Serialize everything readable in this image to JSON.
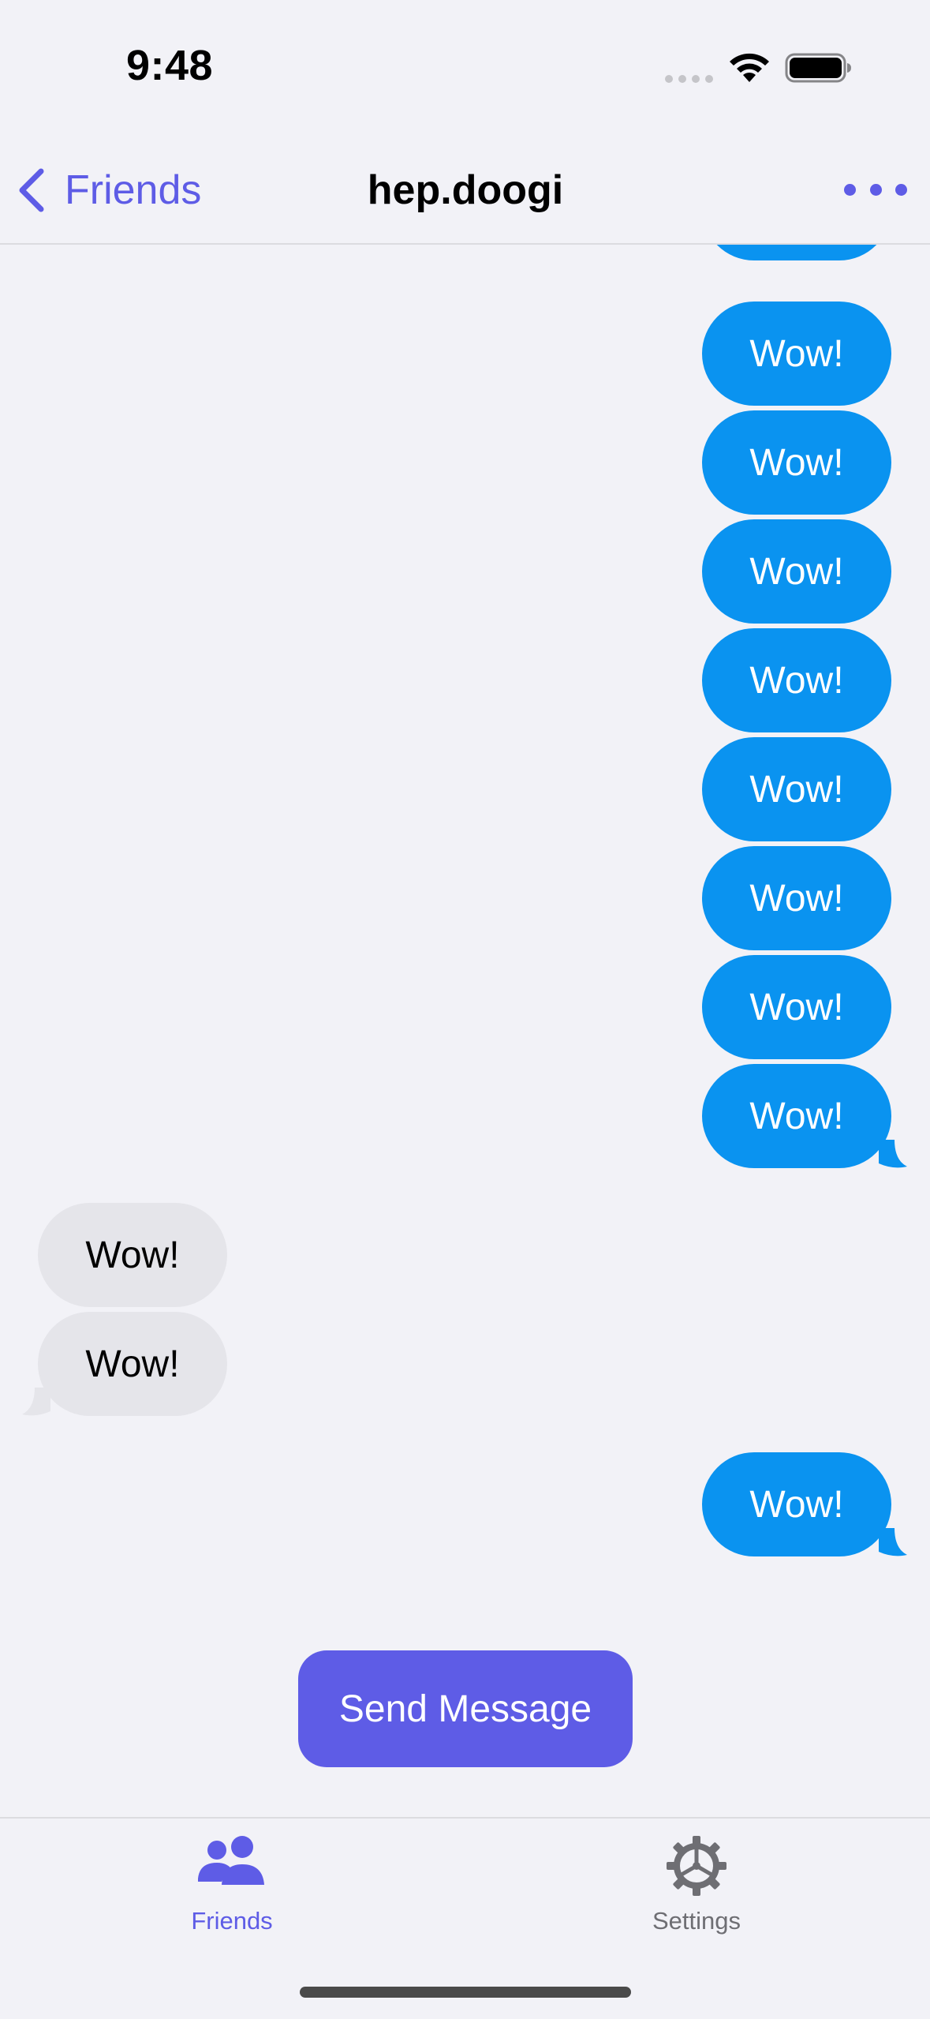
{
  "status_bar": {
    "time": "9:48",
    "wifi_icon": "wifi-icon",
    "battery_icon": "battery-full-icon"
  },
  "nav": {
    "back_label": "Friends",
    "back_icon": "chevron-left-icon",
    "title": "hep.doogi",
    "more_icon": "ellipsis-icon"
  },
  "messages": [
    {
      "direction": "out",
      "text": "Wow!"
    },
    {
      "direction": "out",
      "text": "Wow!"
    },
    {
      "direction": "out",
      "text": "Wow!"
    },
    {
      "direction": "out",
      "text": "Wow!"
    },
    {
      "direction": "out",
      "text": "Wow!"
    },
    {
      "direction": "out",
      "text": "Wow!"
    },
    {
      "direction": "out",
      "text": "Wow!"
    },
    {
      "direction": "out",
      "text": "Wow!"
    },
    {
      "direction": "in",
      "text": "Wow!"
    },
    {
      "direction": "in",
      "text": "Wow!"
    },
    {
      "direction": "out",
      "text": "Wow!"
    }
  ],
  "send_button": {
    "label": "Send Message"
  },
  "tabs": [
    {
      "label": "Friends",
      "icon": "people-icon",
      "selected": true
    },
    {
      "label": "Settings",
      "icon": "gear-icon",
      "selected": false
    }
  ],
  "colors": {
    "accent": "#5e5ce6",
    "outgoing_bubble": "#0a93f0",
    "incoming_bubble": "#e5e5ea",
    "background": "#f2f2f7"
  }
}
